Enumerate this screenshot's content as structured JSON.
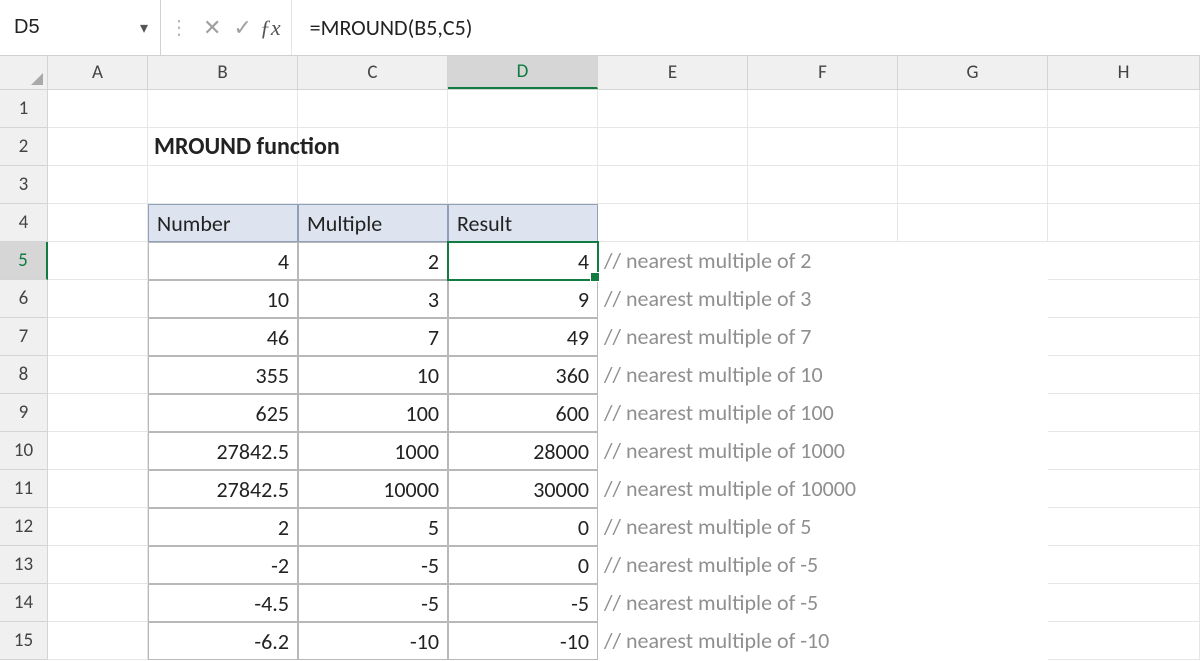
{
  "nameBox": "D5",
  "formula": "=MROUND(B5,C5)",
  "columns": [
    "A",
    "B",
    "C",
    "D",
    "E",
    "F",
    "G",
    "H"
  ],
  "activeCol": "D",
  "activeRow": 5,
  "title": "MROUND function",
  "headers": {
    "b": "Number",
    "c": "Multiple",
    "d": "Result"
  },
  "rows": [
    {
      "r": 5,
      "b": "4",
      "c": "2",
      "d": "4",
      "e": "// nearest multiple of 2"
    },
    {
      "r": 6,
      "b": "10",
      "c": "3",
      "d": "9",
      "e": "// nearest multiple of 3"
    },
    {
      "r": 7,
      "b": "46",
      "c": "7",
      "d": "49",
      "e": "// nearest multiple of 7"
    },
    {
      "r": 8,
      "b": "355",
      "c": "10",
      "d": "360",
      "e": "// nearest multiple of 10"
    },
    {
      "r": 9,
      "b": "625",
      "c": "100",
      "d": "600",
      "e": "// nearest multiple of 100"
    },
    {
      "r": 10,
      "b": "27842.5",
      "c": "1000",
      "d": "28000",
      "e": "// nearest multiple of 1000"
    },
    {
      "r": 11,
      "b": "27842.5",
      "c": "10000",
      "d": "30000",
      "e": "// nearest multiple of 10000"
    },
    {
      "r": 12,
      "b": "2",
      "c": "5",
      "d": "0",
      "e": "// nearest multiple of 5"
    },
    {
      "r": 13,
      "b": "-2",
      "c": "-5",
      "d": "0",
      "e": "// nearest multiple of -5"
    },
    {
      "r": 14,
      "b": "-4.5",
      "c": "-5",
      "d": "-5",
      "e": "// nearest multiple of -5"
    },
    {
      "r": 15,
      "b": "-6.2",
      "c": "-10",
      "d": "-10",
      "e": "// nearest multiple of -10"
    }
  ]
}
